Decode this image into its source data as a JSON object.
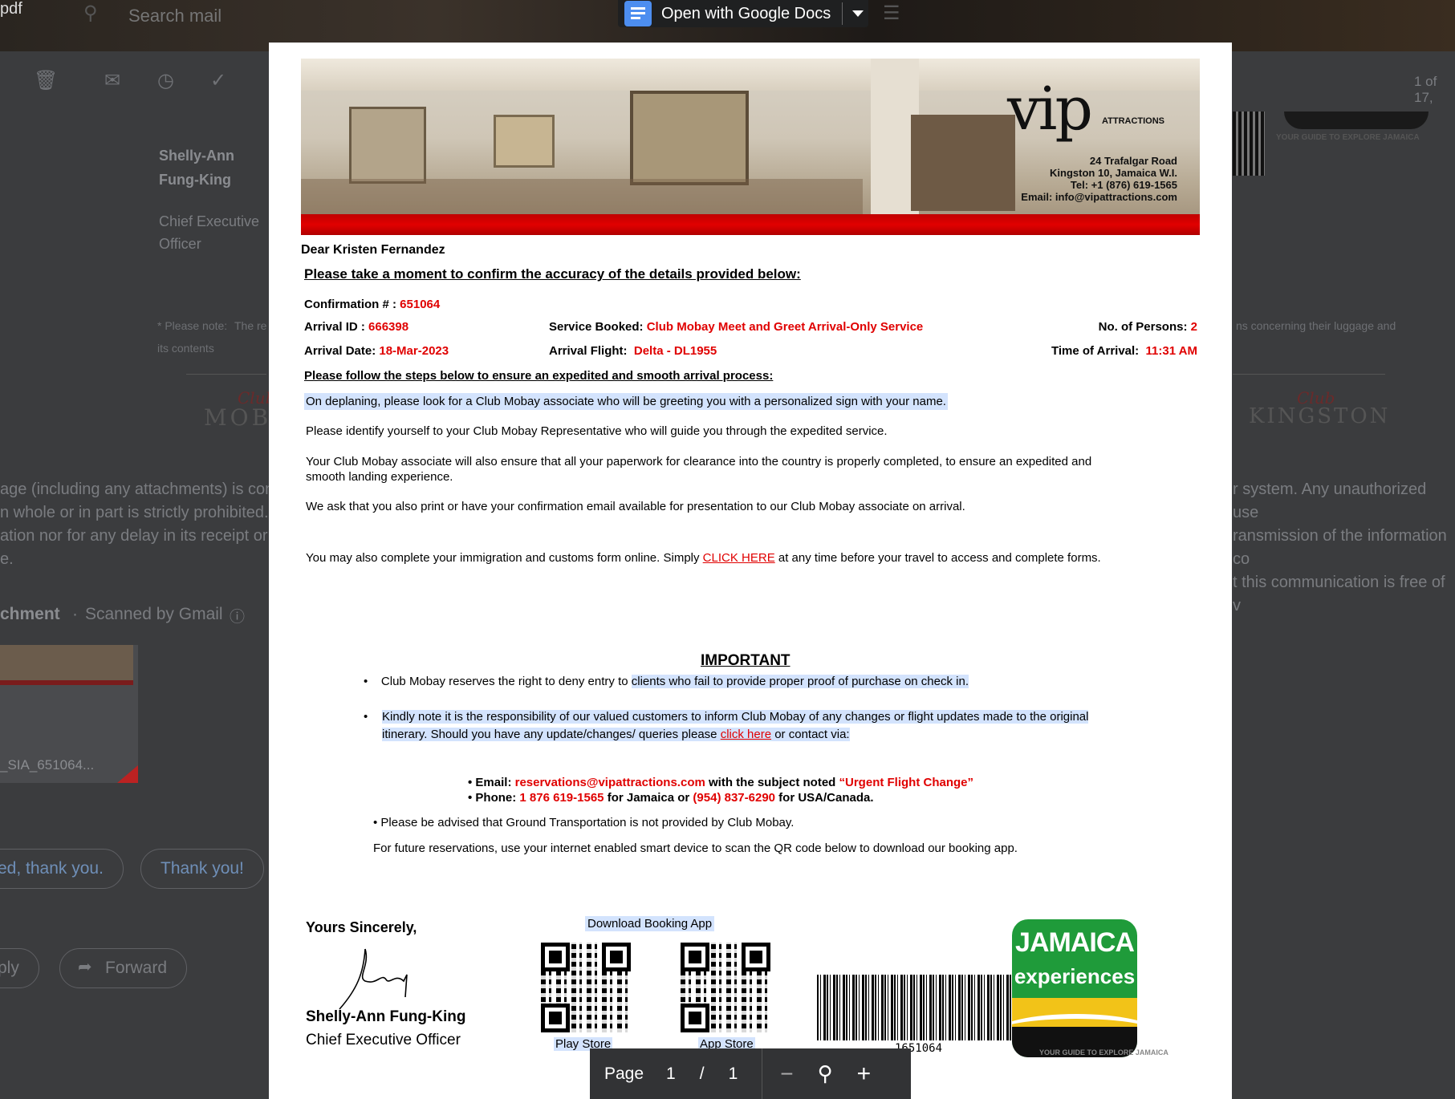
{
  "gmail": {
    "app_label": "pdf",
    "search_placeholder": "Search mail",
    "pager": "1 of 17,",
    "sender_name_line1": "Shelly-Ann",
    "sender_name_line2": "Fung-King",
    "sender_title_line1": "Chief Executive",
    "sender_title_line2": "Officer",
    "note_prefix": "* Please note:",
    "note_text_left": "The re",
    "note_text_left2": "its contents",
    "note_text_right": "ns concerning their luggage and",
    "club_left_script": "Club",
    "club_left": "MOB",
    "club_right_script": "Club",
    "club_right": "KINGSTON",
    "disclaimer_left": [
      "age (including any attachments) is conf",
      "n whole or in part is strictly prohibited. F",
      "ation nor for any delay in its receipt or d",
      "e."
    ],
    "disclaimer_right": [
      "r system. Any unauthorized use",
      "ransmission of the information co",
      "t this communication is free of v"
    ],
    "attachment_label": "chment",
    "scanned_label": "Scanned by Gmail",
    "attachment_file": "_SIA_651064...",
    "smart_reply_1": "ed, thank you.",
    "smart_reply_2": "Thank you!",
    "reply_label": "ply",
    "forward_label": "Forward",
    "tagline_bg": "YOUR GUIDE TO EXPLORE JAMAICA"
  },
  "viewer": {
    "open_with": "Open with Google Docs",
    "page_label": "Page",
    "page_current": "1",
    "page_sep": "/",
    "page_total": "1"
  },
  "letter": {
    "address_lines": [
      "24 Trafalgar Road",
      "Kingston 10, Jamaica W.I.",
      "Tel: +1 (876) 619-1565",
      "Email: info@vipattractions.com"
    ],
    "logo_text": "vip",
    "logo_sub": "ATTRACTIONS",
    "greeting": "Dear Kristen Fernandez",
    "confirm_heading": "Please take a moment to confirm the accuracy of the details provided below:",
    "confirmation_label": "Confirmation # :",
    "confirmation_value": "651064",
    "arrival_id_label": "Arrival ID :",
    "arrival_id_value": "666398",
    "service_label": "Service Booked:",
    "service_value": "Club Mobay Meet and Greet Arrival-Only Service",
    "persons_label": "No. of Persons:",
    "persons_value": "2",
    "arrival_date_label": "Arrival Date:",
    "arrival_date_value": "18-Mar-2023",
    "flight_label": "Arrival Flight:",
    "flight_value": "Delta - DL1955",
    "time_label": "Time of Arrival:",
    "time_value": "11:31 AM",
    "steps_heading": "Please follow the steps below to ensure an expedited and smooth arrival process:",
    "step1": "On deplaning, please look for a Club Mobay associate who will be greeting you with a personalized sign with your name.",
    "step2": "Please identify yourself to your Club Mobay Representative who will guide you through the expedited service.",
    "step3a": "Your Club Mobay associate will also ensure that all your paperwork for clearance into the country is properly completed, to ensure an expedited and",
    "step3b": "smooth landing experience.",
    "step4": "We ask that you also print or have your confirmation email available for presentation to our Club Mobay associate on arrival.",
    "immigration_pre": "You may also complete your immigration and customs form online. Simply",
    "immigration_link": "CLICK HERE",
    "immigration_post": "at any time before your travel to access and complete forms.",
    "important_heading": "IMPORTANT",
    "bullet1_pre": "Club Mobay reserves the right to deny entry to",
    "bullet1_hl": "clients who fail to provide proper proof of purchase on check in.",
    "bullet2a": "Kindly note it is the responsibility of our valued customers to inform Club Mobay of any changes or flight updates made to the original",
    "bullet2b_pre": "itinerary. Should you have any update/changes/ queries please",
    "bullet2b_link": "click here",
    "bullet2b_post": "or contact via:",
    "email_label": "• Email:",
    "email_value": "reservations@vipattractions.com",
    "email_mid": "with the subject noted",
    "email_subject": "“Urgent Flight Change”",
    "phone_label": "• Phone:",
    "phone_jm": "1 876 619-1565",
    "phone_mid": "for Jamaica or",
    "phone_us": "(954) 837-6290",
    "phone_post": "for USA/Canada.",
    "transport": "•  Please be advised that Ground Transportation is not provided by Club Mobay.",
    "future": "For future reservations, use your internet enabled smart device to scan the QR code below to download our booking app.",
    "sincerely": "Yours Sincerely,",
    "signer": "Shelly-Ann Fung-King",
    "signer_title": "Chief Executive Officer",
    "download_app": "Download Booking App",
    "play_store": "Play Store",
    "app_store": "App Store",
    "barcode_number": "1651064",
    "jam_line1": "JAMAICA",
    "jam_line2": "experiences",
    "jam_tagline": "YOUR GUIDE TO EXPLORE JAMAICA"
  },
  "colors": {
    "accent_red": "#e00000",
    "highlight": "#d3e3fd",
    "jamaica_green": "#1f9b3a",
    "jamaica_yellow": "#f2c318"
  }
}
